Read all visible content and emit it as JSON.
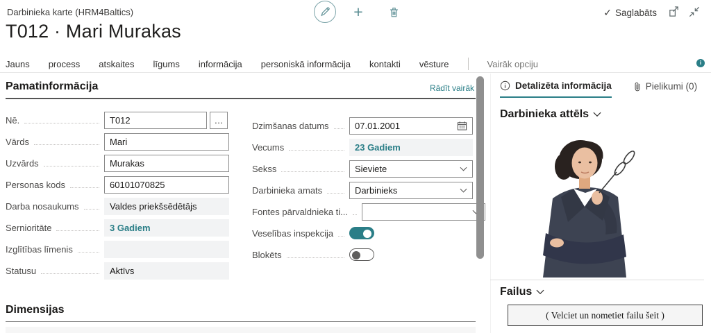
{
  "window": {
    "breadcrumb": "Darbinieka karte (HRM4Baltics)",
    "title": "T012 · Mari Murakas",
    "saved": "Saglabāts"
  },
  "icons": {
    "check": "✓",
    "plus": "+",
    "ellipsis": "…"
  },
  "ribbon": {
    "items": [
      "Jauns",
      "process",
      "atskaites",
      "līgums",
      "informācija",
      "personiskā informācija",
      "kontakti",
      "vēsture"
    ],
    "more": "Vairāk opciju"
  },
  "pamatinformacija": {
    "title": "Pamatinformācija",
    "show_more": "Rādīt vairāk",
    "left_fields": [
      {
        "label": "Nē.",
        "value": "T012",
        "type": "input-ellipsis"
      },
      {
        "label": "Vārds",
        "value": "Mari",
        "type": "input"
      },
      {
        "label": "Uzvārds",
        "value": "Murakas",
        "type": "input"
      },
      {
        "label": "Personas kods",
        "value": "60101070825",
        "type": "input"
      },
      {
        "label": "Darba nosaukums",
        "value": "Valdes priekšsēdētājs",
        "type": "readonly"
      },
      {
        "label": "Sernioritāte",
        "value": "3 Gadiem",
        "type": "readonly-link"
      },
      {
        "label": "Izglītības līmenis",
        "value": "",
        "type": "readonly"
      },
      {
        "label": "Statusu",
        "value": "Aktīvs",
        "type": "readonly"
      }
    ],
    "right_fields": [
      {
        "label": "Dzimšanas datums",
        "value": "07.01.2001",
        "type": "date"
      },
      {
        "label": "Vecums",
        "value": "23 Gadiem",
        "type": "readonly-link"
      },
      {
        "label": "Sekss",
        "value": "Sieviete",
        "type": "dropdown"
      },
      {
        "label": "Darbinieka amats",
        "value": "Darbinieks",
        "type": "dropdown"
      },
      {
        "label": "Fontes pārvaldnieka ti...",
        "value": "",
        "type": "dropdown"
      },
      {
        "label": "Veselības inspekcija",
        "value": "on",
        "type": "toggle"
      },
      {
        "label": "Blokēts",
        "value": "off",
        "type": "toggle"
      }
    ]
  },
  "dimensijas": {
    "title": "Dimensijas"
  },
  "factbox": {
    "tab_details": "Detalizēta informācija",
    "tab_attachments": "Pielikumi (0)",
    "photo_section": "Darbinieka attēls",
    "files_section": "Failus",
    "dropzone": "( Velciet un nometiet failu šeit )"
  },
  "colors": {
    "accent": "#2a7e87",
    "icon_teal": "#5a8d93",
    "readonly_bg": "#f2f3f4"
  }
}
